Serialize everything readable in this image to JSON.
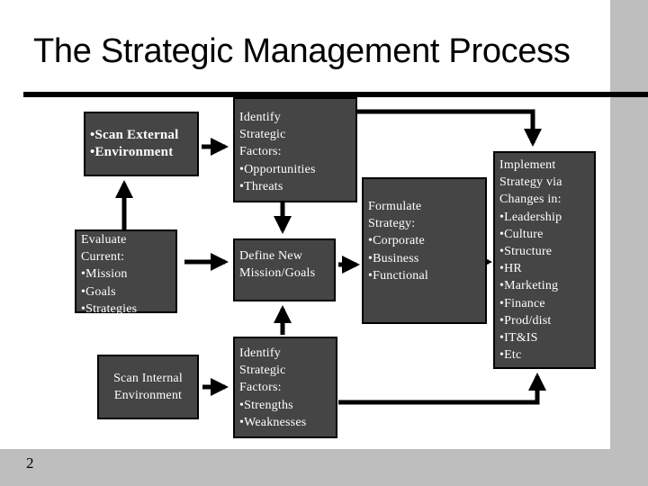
{
  "slide": {
    "title": "The Strategic Management Process",
    "page_number": "2"
  },
  "colors": {
    "box_fill": "#454545",
    "box_text": "#ffffff",
    "frame_gray": "#bebebe",
    "arrow": "#000000"
  },
  "boxes": {
    "scan_external": {
      "lines": [
        "•Scan External",
        "•Environment"
      ]
    },
    "identify_external": {
      "lines": [
        "Identify",
        "Strategic",
        "Factors:",
        "•Opportunities",
        "•Threats"
      ]
    },
    "evaluate_current": {
      "lines": [
        "Evaluate",
        "Current:",
        "•Mission",
        "•Goals",
        "•Strategies"
      ]
    },
    "define_mission": {
      "lines": [
        "Define New",
        "Mission/Goals"
      ]
    },
    "scan_internal": {
      "lines": [
        "Scan  Internal",
        "Environment"
      ]
    },
    "identify_internal": {
      "lines": [
        "Identify",
        "Strategic",
        "Factors:",
        "•Strengths",
        "•Weaknesses"
      ]
    },
    "formulate_strategy": {
      "lines": [
        "Formulate",
        "Strategy:",
        "•Corporate",
        "•Business",
        "•Functional"
      ]
    },
    "implement_strategy": {
      "lines": [
        "Implement",
        "Strategy via",
        "Changes  in:",
        "•Leadership",
        "•Culture",
        "•Structure",
        "•HR",
        "•Marketing",
        "•Finance",
        "•Prod/dist",
        "•IT&IS",
        "•Etc"
      ]
    }
  },
  "connections": [
    {
      "from": "evaluate_current",
      "to": "scan_external"
    },
    {
      "from": "scan_external",
      "to": "identify_external"
    },
    {
      "from": "identify_external",
      "to": "define_mission"
    },
    {
      "from": "identify_external",
      "to": "implement_strategy"
    },
    {
      "from": "evaluate_current",
      "to": "define_mission"
    },
    {
      "from": "scan_internal",
      "to": "identify_internal"
    },
    {
      "from": "identify_internal",
      "to": "define_mission"
    },
    {
      "from": "identify_internal",
      "to": "implement_strategy"
    },
    {
      "from": "define_mission",
      "to": "formulate_strategy"
    },
    {
      "from": "formulate_strategy",
      "to": "implement_strategy"
    }
  ]
}
